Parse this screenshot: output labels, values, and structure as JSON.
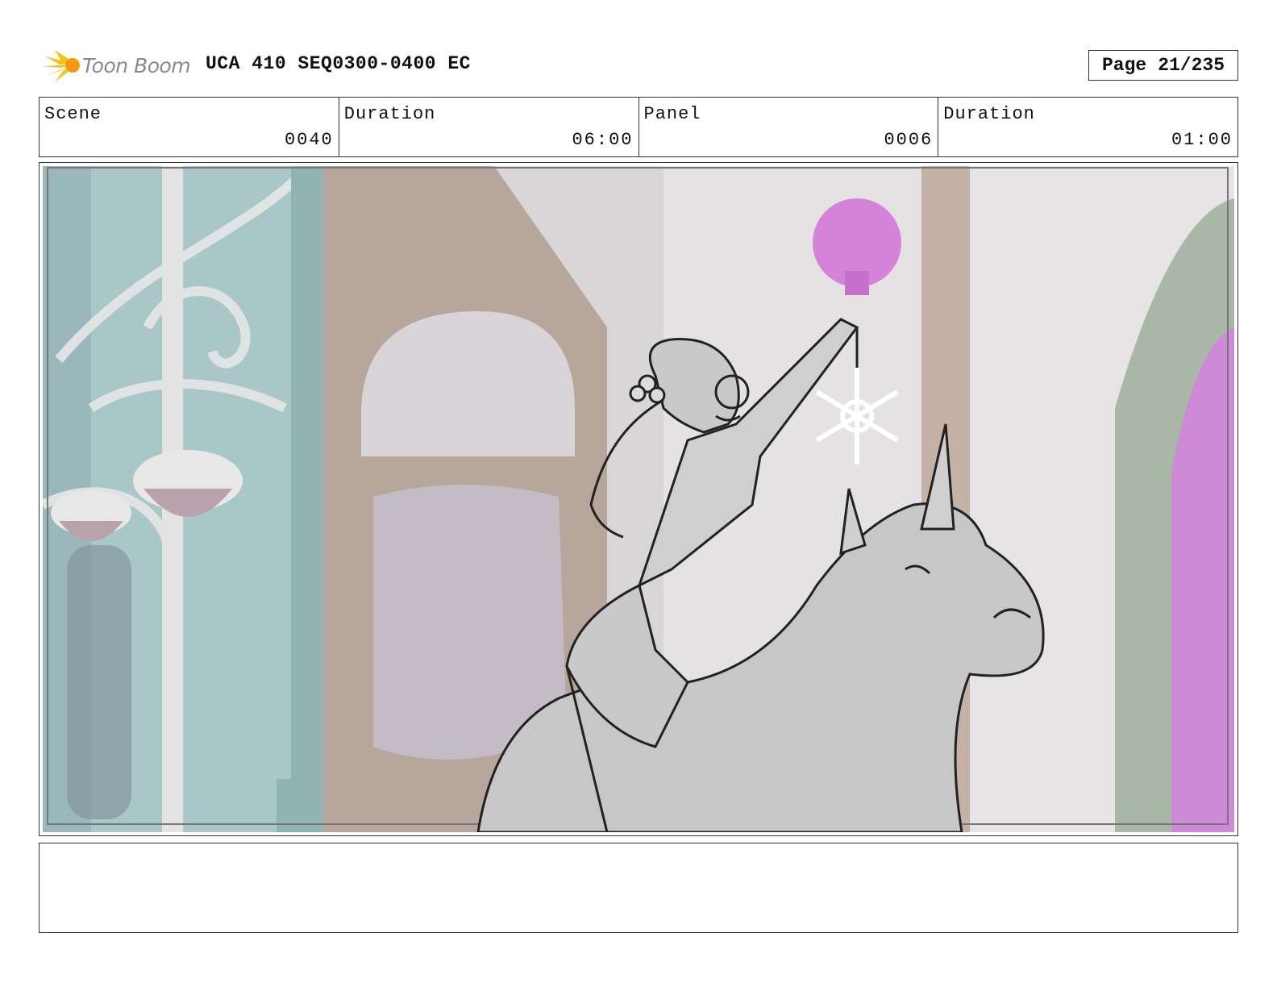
{
  "header": {
    "logo_text": "Toon Boom",
    "title": "UCA 410 SEQ0300-0400 EC",
    "page_label": "Page",
    "page_value": "21/235"
  },
  "info": [
    {
      "label": "Scene",
      "value": "0040"
    },
    {
      "label": "Duration",
      "value": "06:00"
    },
    {
      "label": "Panel",
      "value": "0006"
    },
    {
      "label": "Duration",
      "value": "01:00"
    }
  ],
  "notes": ""
}
